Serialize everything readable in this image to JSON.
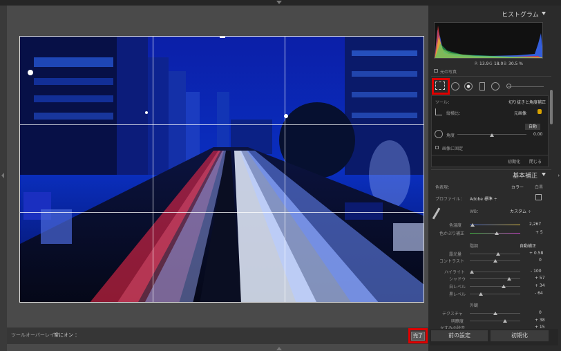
{
  "toolbar": {
    "overlay_label": "ツールオーバーレイ：",
    "overlay_value": "常にオン ：",
    "done_label": "完了"
  },
  "panel": {
    "histogram_title": "ヒストグラム",
    "rgb_readout": {
      "r_label": "R",
      "r_value": "13.9",
      "g_label": "G",
      "g_value": "18.0",
      "b_label": "B",
      "b_value": "30.5 %"
    },
    "original_photo_label": "元の写真",
    "tool_label": "ツール：",
    "tool_value": "切り抜きと角度補正",
    "aspect_label": "縦横比：",
    "aspect_value": "元画像",
    "auto_label": "自動",
    "angle_label": "角度",
    "angle_value": "0.00",
    "constrain_label": "画像に固定",
    "reset_label": "初期化",
    "close_label": "閉じる",
    "basic_title": "基本補正",
    "treatment_label": "色表現：",
    "treatment_color": "カラー",
    "treatment_bw": "白黒",
    "profile_label": "プロファイル：",
    "profile_value": "Adobe 標準 ÷",
    "wb_label": "WB：",
    "wb_value": "カスタム ÷",
    "temp_label": "色温度",
    "temp_value": "2,267",
    "tint_label": "色かぶり補正",
    "tint_value": "+ 5",
    "tone_label": "階調",
    "auto_tone_label": "自動補正",
    "exposure_label": "露光量",
    "exposure_value": "+ 0.58",
    "contrast_label": "コントラスト",
    "contrast_value": "0",
    "highlights_label": "ハイライト",
    "highlights_value": "- 100",
    "shadows_label": "シャドウ",
    "shadows_value": "+ 57",
    "whites_label": "白レベル",
    "whites_value": "+ 34",
    "blacks_label": "黒レベル",
    "blacks_value": "- 64",
    "presence_label": "外観",
    "texture_label": "テクスチャ",
    "texture_value": "0",
    "clarity_label": "明瞭度",
    "clarity_value": "+ 38",
    "dehaze_label": "かすみの除去",
    "dehaze_value": "+ 15",
    "prev_label": "前の設定",
    "reset_bottom_label": "初期化"
  },
  "colors": {
    "highlight_red": "#e00000",
    "photo_blue": "#0a1a9a"
  }
}
